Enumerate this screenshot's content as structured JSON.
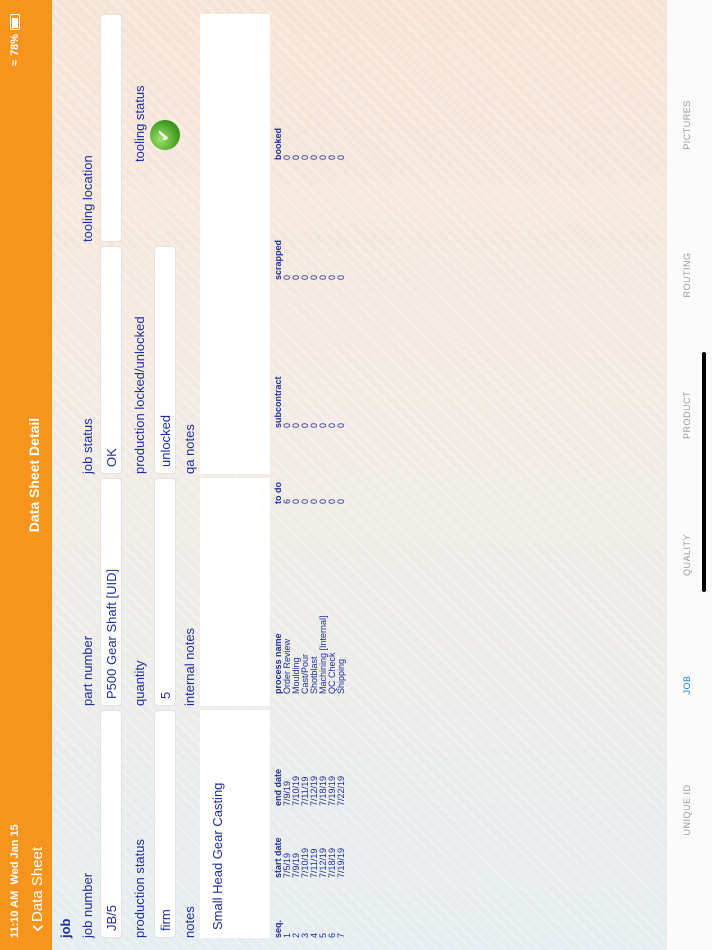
{
  "status_bar": {
    "time": "11:10 AM",
    "date": "Wed Jan 15",
    "battery": "78%"
  },
  "nav": {
    "back_label": "Data Sheet",
    "title": "Data Sheet Detail"
  },
  "section_title": "job",
  "labels": {
    "job_number": "job number",
    "part_number": "part number",
    "job_status": "job status",
    "tooling_location": "tooling location",
    "production_status": "production status",
    "quantity": "quantity",
    "production_locked": "production locked/unlocked",
    "tooling_status": "tooling status",
    "notes": "notes",
    "internal_notes": "internal notes",
    "qa_notes": "qa notes"
  },
  "values": {
    "job_number": "JB/5",
    "part_number": "P500 Gear Shaft [UID]",
    "job_status": "OK",
    "tooling_location": "",
    "production_status": "firm",
    "quantity": "5",
    "production_locked": "unlocked",
    "notes": "Small Head Gear Casting",
    "internal_notes": "",
    "qa_notes": ""
  },
  "tooling_status_icon": "check-circle-icon",
  "steps": {
    "headers": [
      "seq.",
      "start date",
      "end date",
      "process name",
      "to do",
      "subcontract",
      "scrapped",
      "booked"
    ],
    "rows": [
      [
        "1",
        "7/5/19",
        "7/9/19",
        "Order Review",
        "6",
        "0",
        "0",
        "0"
      ],
      [
        "2",
        "7/9/19",
        "7/10/19",
        "Moulding",
        "0",
        "0",
        "0",
        "0"
      ],
      [
        "3",
        "7/10/19",
        "7/11/19",
        "Cast/Pour",
        "0",
        "0",
        "0",
        "0"
      ],
      [
        "4",
        "7/11/19",
        "7/12/19",
        "Shotblast",
        "0",
        "0",
        "0",
        "0"
      ],
      [
        "5",
        "7/12/19",
        "7/18/19",
        "Machining [Internal]",
        "0",
        "0",
        "0",
        "0"
      ],
      [
        "6",
        "7/18/19",
        "7/19/19",
        "QC Check",
        "0",
        "0",
        "0",
        "0"
      ],
      [
        "7",
        "7/19/19",
        "7/22/19",
        "Shipping",
        "0",
        "0",
        "0",
        "0"
      ]
    ]
  },
  "tabs": [
    {
      "label": "UNIQUE ID",
      "active": false
    },
    {
      "label": "JOB",
      "active": true
    },
    {
      "label": "QUALITY",
      "active": false
    },
    {
      "label": "PRODUCT",
      "active": false
    },
    {
      "label": "ROUTING",
      "active": false
    },
    {
      "label": "PICTURES",
      "active": false
    }
  ],
  "colors": {
    "accent": "#f7941d",
    "text": "#1f2e9a",
    "tab_active": "#1b7fd9"
  }
}
